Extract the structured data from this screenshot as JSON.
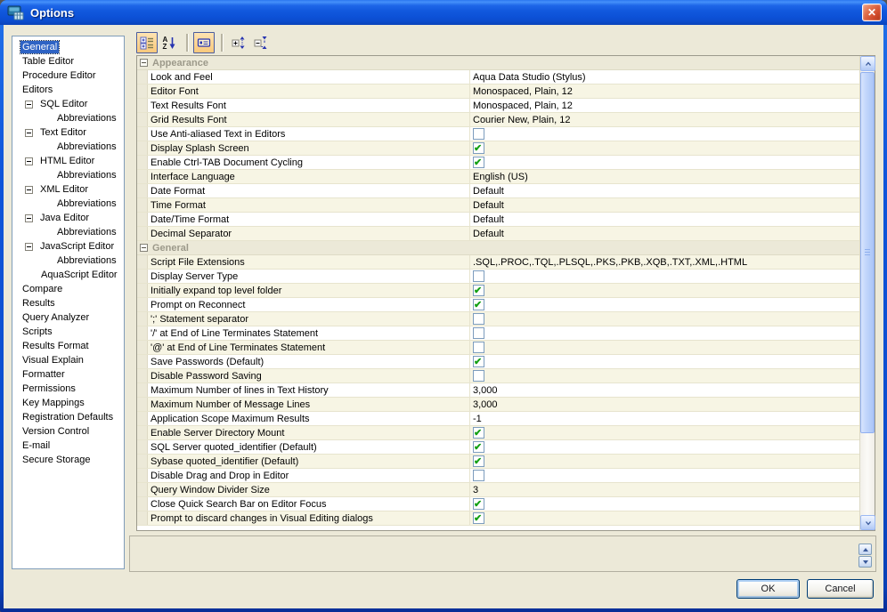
{
  "window": {
    "title": "Options",
    "close_glyph": "✕"
  },
  "sidebar": {
    "items": [
      {
        "label": "General",
        "level": 0,
        "toggle": false,
        "selected": true
      },
      {
        "label": "Table Editor",
        "level": 0,
        "toggle": false
      },
      {
        "label": "Procedure Editor",
        "level": 0,
        "toggle": false
      },
      {
        "label": "Editors",
        "level": 0,
        "toggle": false
      },
      {
        "label": "SQL Editor",
        "level": 1,
        "toggle": true
      },
      {
        "label": "Abbreviations",
        "level": 2,
        "toggle": false
      },
      {
        "label": "Text Editor",
        "level": 1,
        "toggle": true
      },
      {
        "label": "Abbreviations",
        "level": 2,
        "toggle": false
      },
      {
        "label": "HTML Editor",
        "level": 1,
        "toggle": true
      },
      {
        "label": "Abbreviations",
        "level": 2,
        "toggle": false
      },
      {
        "label": "XML Editor",
        "level": 1,
        "toggle": true
      },
      {
        "label": "Abbreviations",
        "level": 2,
        "toggle": false
      },
      {
        "label": "Java Editor",
        "level": 1,
        "toggle": true
      },
      {
        "label": "Abbreviations",
        "level": 2,
        "toggle": false
      },
      {
        "label": "JavaScript Editor",
        "level": 1,
        "toggle": true
      },
      {
        "label": "Abbreviations",
        "level": 2,
        "toggle": false
      },
      {
        "label": "AquaScript Editor",
        "level": 1,
        "toggle": false
      },
      {
        "label": "Compare",
        "level": 0,
        "toggle": false
      },
      {
        "label": "Results",
        "level": 0,
        "toggle": false
      },
      {
        "label": "Query Analyzer",
        "level": 0,
        "toggle": false
      },
      {
        "label": "Scripts",
        "level": 0,
        "toggle": false
      },
      {
        "label": "Results Format",
        "level": 0,
        "toggle": false
      },
      {
        "label": "Visual Explain",
        "level": 0,
        "toggle": false
      },
      {
        "label": "Formatter",
        "level": 0,
        "toggle": false
      },
      {
        "label": "Permissions",
        "level": 0,
        "toggle": false
      },
      {
        "label": "Key Mappings",
        "level": 0,
        "toggle": false
      },
      {
        "label": "Registration Defaults",
        "level": 0,
        "toggle": false
      },
      {
        "label": "Version Control",
        "level": 0,
        "toggle": false
      },
      {
        "label": "E-mail",
        "level": 0,
        "toggle": false
      },
      {
        "label": "Secure Storage",
        "level": 0,
        "toggle": false
      }
    ]
  },
  "toolbar": {
    "buttons": [
      {
        "name": "categorized-view",
        "pressed": true
      },
      {
        "name": "alphabetical-sort",
        "pressed": false
      },
      {
        "name": "show-description",
        "pressed": true
      },
      {
        "name": "expand-all",
        "pressed": false
      },
      {
        "name": "collapse-all",
        "pressed": false
      }
    ]
  },
  "grid": {
    "sections": [
      {
        "title": "Appearance",
        "rows": [
          {
            "label": "Look and Feel",
            "type": "text",
            "value": "Aqua Data Studio (Stylus)"
          },
          {
            "label": "Editor Font",
            "type": "text",
            "value": "Monospaced, Plain, 12"
          },
          {
            "label": "Text Results Font",
            "type": "text",
            "value": "Monospaced, Plain, 12"
          },
          {
            "label": "Grid Results Font",
            "type": "text",
            "value": "Courier New, Plain, 12"
          },
          {
            "label": "Use Anti-aliased Text in Editors",
            "type": "checkbox",
            "checked": false
          },
          {
            "label": "Display Splash Screen",
            "type": "checkbox",
            "checked": true
          },
          {
            "label": "Enable Ctrl-TAB Document Cycling",
            "type": "checkbox",
            "checked": true
          },
          {
            "label": "Interface Language",
            "type": "text",
            "value": "English (US)"
          },
          {
            "label": "Date Format",
            "type": "text",
            "value": "Default"
          },
          {
            "label": "Time Format",
            "type": "text",
            "value": "Default"
          },
          {
            "label": "Date/Time Format",
            "type": "text",
            "value": "Default"
          },
          {
            "label": "Decimal Separator",
            "type": "text",
            "value": "Default"
          }
        ]
      },
      {
        "title": "General",
        "rows": [
          {
            "label": "Script File Extensions",
            "type": "text",
            "value": ".SQL,.PROC,.TQL,.PLSQL,.PKS,.PKB,.XQB,.TXT,.XML,.HTML"
          },
          {
            "label": "Display Server Type",
            "type": "checkbox",
            "checked": false
          },
          {
            "label": "Initially expand top level folder",
            "type": "checkbox",
            "checked": true
          },
          {
            "label": "Prompt on Reconnect",
            "type": "checkbox",
            "checked": true
          },
          {
            "label": "';' Statement separator",
            "type": "checkbox",
            "checked": false
          },
          {
            "label": "'/' at End of Line Terminates Statement",
            "type": "checkbox",
            "checked": false
          },
          {
            "label": "'@' at End of Line Terminates Statement",
            "type": "checkbox",
            "checked": false
          },
          {
            "label": "Save Passwords (Default)",
            "type": "checkbox",
            "checked": true
          },
          {
            "label": "Disable Password Saving",
            "type": "checkbox",
            "checked": false
          },
          {
            "label": "Maximum Number of lines in Text History",
            "type": "text",
            "value": "3,000"
          },
          {
            "label": "Maximum Number of Message Lines",
            "type": "text",
            "value": "3,000"
          },
          {
            "label": "Application Scope Maximum Results",
            "type": "text",
            "value": "-1"
          },
          {
            "label": "Enable Server Directory Mount",
            "type": "checkbox",
            "checked": true
          },
          {
            "label": "SQL Server quoted_identifier (Default)",
            "type": "checkbox",
            "checked": true
          },
          {
            "label": "Sybase quoted_identifier (Default)",
            "type": "checkbox",
            "checked": true
          },
          {
            "label": "Disable Drag and Drop in Editor",
            "type": "checkbox",
            "checked": false
          },
          {
            "label": "Query Window Divider Size",
            "type": "text",
            "value": "3"
          },
          {
            "label": "Close Quick Search Bar on Editor Focus",
            "type": "checkbox",
            "checked": true
          },
          {
            "label": "Prompt to discard changes in Visual Editing dialogs",
            "type": "checkbox",
            "checked": true
          }
        ]
      }
    ]
  },
  "footer": {
    "ok_label": "OK",
    "cancel_label": "Cancel"
  },
  "colors": {
    "titlebar_blue": "#0f55da",
    "client_bg": "#ece9d8",
    "cream_row": "#f7f5e4",
    "selection_blue": "#2e63c4",
    "check_green": "#13a013",
    "close_red": "#d04a2b"
  }
}
